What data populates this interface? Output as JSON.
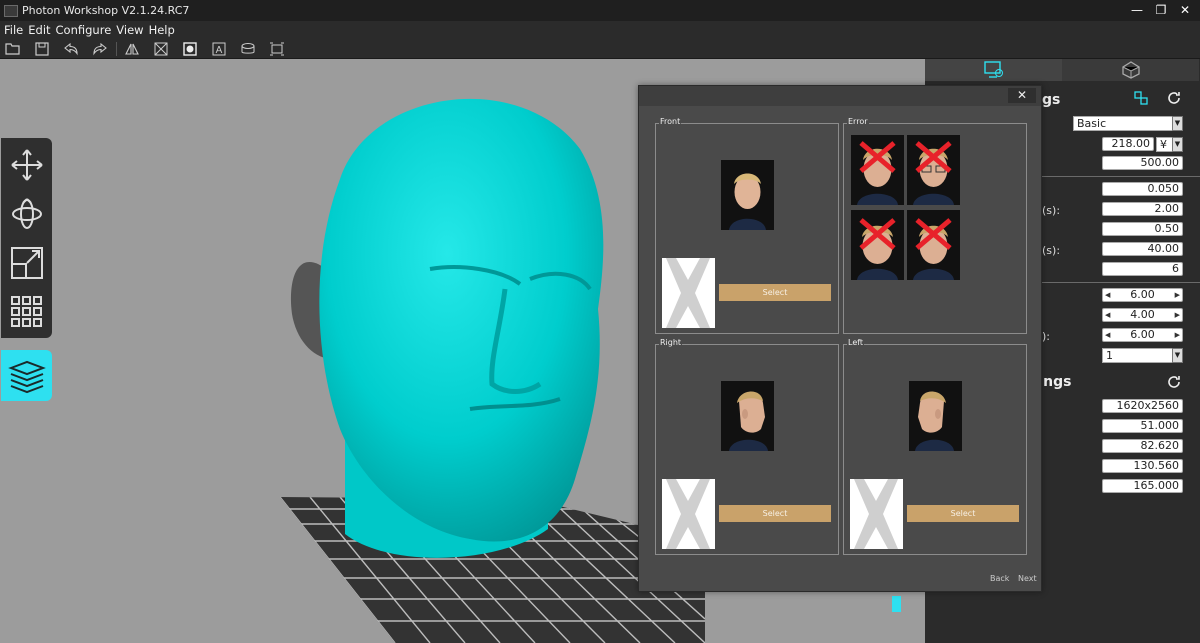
{
  "window": {
    "title": "Photon Workshop V2.1.24.RC7"
  },
  "menu": [
    "File",
    "Edit",
    "Configure",
    "View",
    "Help"
  ],
  "toolbar": [
    "open-icon",
    "save-icon",
    "undo-icon",
    "redo-icon",
    "mirror-icon",
    "support-icon",
    "hollow-icon",
    "text-icon",
    "punch-icon",
    "repair-icon"
  ],
  "right_panel": {
    "heading1_partial": "gs",
    "heading2_partial": "ttings",
    "labels": [
      "(s):",
      "(s):",
      "):"
    ],
    "profile": "Basic",
    "price": "218.00",
    "currency": "¥",
    "volume": "500.00",
    "values_a": [
      "0.050",
      "2.00",
      "0.50",
      "40.00",
      "6"
    ],
    "spins": [
      "6.00",
      "4.00",
      "6.00"
    ],
    "count": "1",
    "values_b": [
      "1620x2560",
      "51.000",
      "82.620",
      "130.560",
      "165.000"
    ]
  },
  "dialog": {
    "close": "✕",
    "front_label": "Front",
    "error_label": "Error",
    "right_label": "Right",
    "left_label": "Left",
    "select": "Select",
    "back": "Back",
    "next": "Next"
  },
  "colors": {
    "accent": "#2ee0f0",
    "button": "#c9a26a",
    "model": "#00d2d2"
  }
}
